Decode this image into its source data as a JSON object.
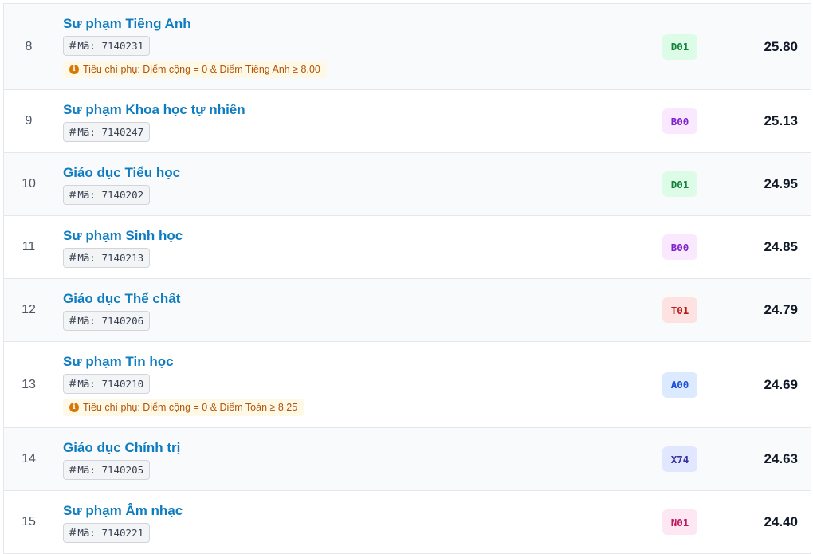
{
  "colors": {
    "link": "#0e7cc0",
    "D01": {
      "bg": "#dcfce7",
      "fg": "#15803d"
    },
    "B00": {
      "bg": "#fae8ff",
      "fg": "#7e22ce"
    },
    "T01": {
      "bg": "#fee2e2",
      "fg": "#b91c1c"
    },
    "A00": {
      "bg": "#dbeafe",
      "fg": "#1d4ed8"
    },
    "X74": {
      "bg": "#e0e7ff",
      "fg": "#3730a3"
    },
    "N01": {
      "bg": "#fce7f3",
      "fg": "#be185d"
    }
  },
  "icons": {
    "code": "hash-icon",
    "criterion": "info-icon"
  },
  "rows": [
    {
      "index": "8",
      "name": "Sư phạm Tiếng Anh",
      "code": "Mã: 7140231",
      "criterion": "Tiêu chí phụ: Điểm cộng = 0 & Điểm Tiếng Anh ≥ 8.00",
      "block": "D01",
      "score": "25.80"
    },
    {
      "index": "9",
      "name": "Sư phạm Khoa học tự nhiên",
      "code": "Mã: 7140247",
      "criterion": "",
      "block": "B00",
      "score": "25.13"
    },
    {
      "index": "10",
      "name": "Giáo dục Tiểu học",
      "code": "Mã: 7140202",
      "criterion": "",
      "block": "D01",
      "score": "24.95"
    },
    {
      "index": "11",
      "name": "Sư phạm Sinh học",
      "code": "Mã: 7140213",
      "criterion": "",
      "block": "B00",
      "score": "24.85"
    },
    {
      "index": "12",
      "name": "Giáo dục Thể chất",
      "code": "Mã: 7140206",
      "criterion": "",
      "block": "T01",
      "score": "24.79"
    },
    {
      "index": "13",
      "name": "Sư phạm Tin học",
      "code": "Mã: 7140210",
      "criterion": "Tiêu chí phụ: Điểm cộng = 0 & Điểm Toán ≥ 8.25",
      "block": "A00",
      "score": "24.69"
    },
    {
      "index": "14",
      "name": "Giáo dục Chính trị",
      "code": "Mã: 7140205",
      "criterion": "",
      "block": "X74",
      "score": "24.63"
    },
    {
      "index": "15",
      "name": "Sư phạm Âm nhạc",
      "code": "Mã: 7140221",
      "criterion": "",
      "block": "N01",
      "score": "24.40"
    }
  ]
}
